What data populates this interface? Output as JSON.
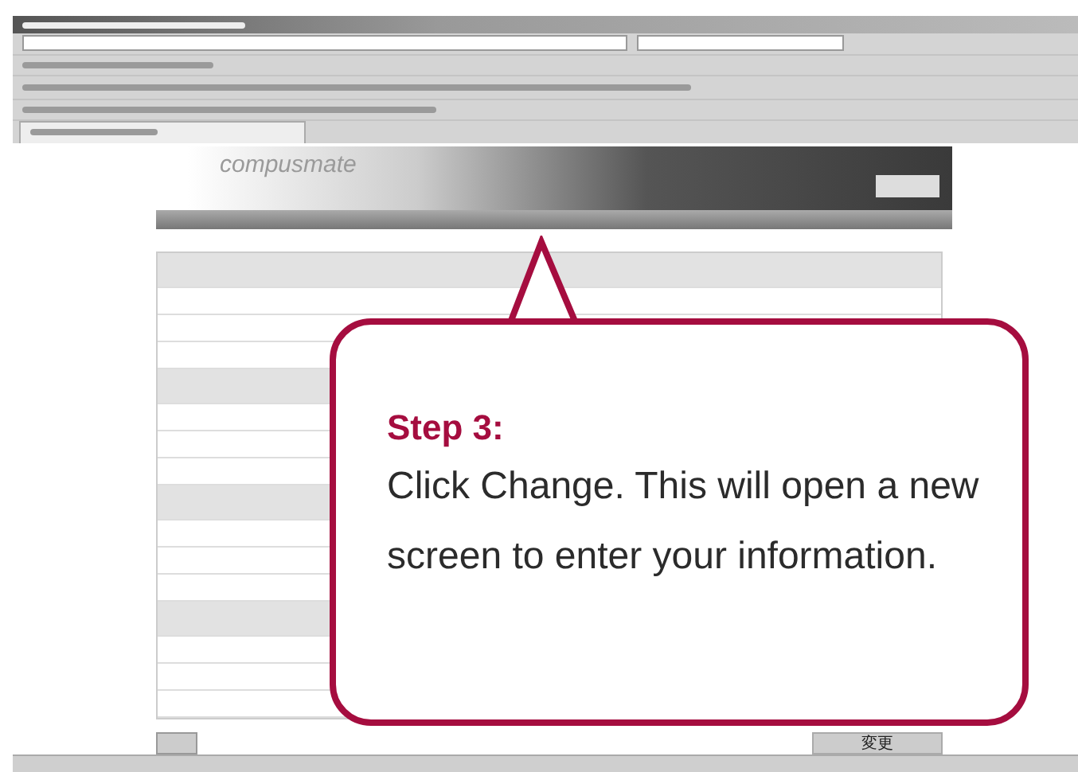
{
  "site": {
    "logo": "compusmate"
  },
  "page": {
    "submit_button": "変更"
  },
  "callout": {
    "heading": "Step 3:",
    "text": "Click Change. This will open a new screen to enter your information."
  }
}
